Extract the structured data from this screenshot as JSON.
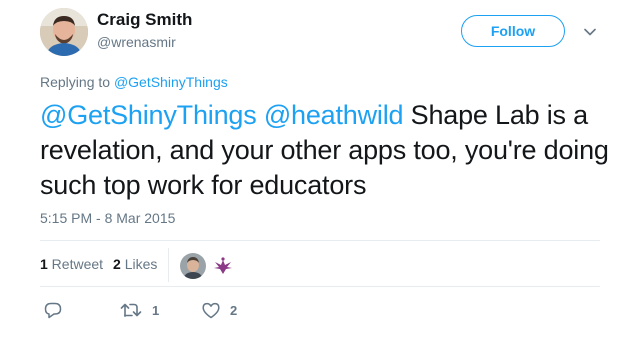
{
  "author": {
    "display_name": "Craig Smith",
    "username": "@wrenasmir",
    "avatar_icon": "user-avatar"
  },
  "follow_button": {
    "label": "Follow",
    "color": "#1da1f2"
  },
  "more_icon": "chevron-down-icon",
  "replying": {
    "prefix": "Replying to ",
    "target": "@GetShinyThings"
  },
  "tweet": {
    "mention_1": "@GetShinyThings",
    "mention_2": "@heathwild",
    "text": " Shape Lab is a revelation, and your other apps too, you're doing such top work for educators"
  },
  "timestamp": "5:15 PM - 8 Mar 2015",
  "stats": {
    "retweets_count": "1",
    "retweets_label": " Retweet",
    "likes_count": "2",
    "likes_label": " Likes"
  },
  "likers": [
    {
      "icon": "user-avatar"
    },
    {
      "icon": "bird-logo-avatar",
      "color": "#8a3a86"
    }
  ],
  "actions": {
    "reply": {
      "icon": "reply-icon"
    },
    "retweet": {
      "icon": "retweet-icon",
      "count": "1"
    },
    "like": {
      "icon": "heart-icon",
      "count": "2"
    }
  },
  "colors": {
    "link": "#1da1f2",
    "muted": "#657786",
    "text": "#14171a",
    "divider": "#e6ecf0"
  }
}
